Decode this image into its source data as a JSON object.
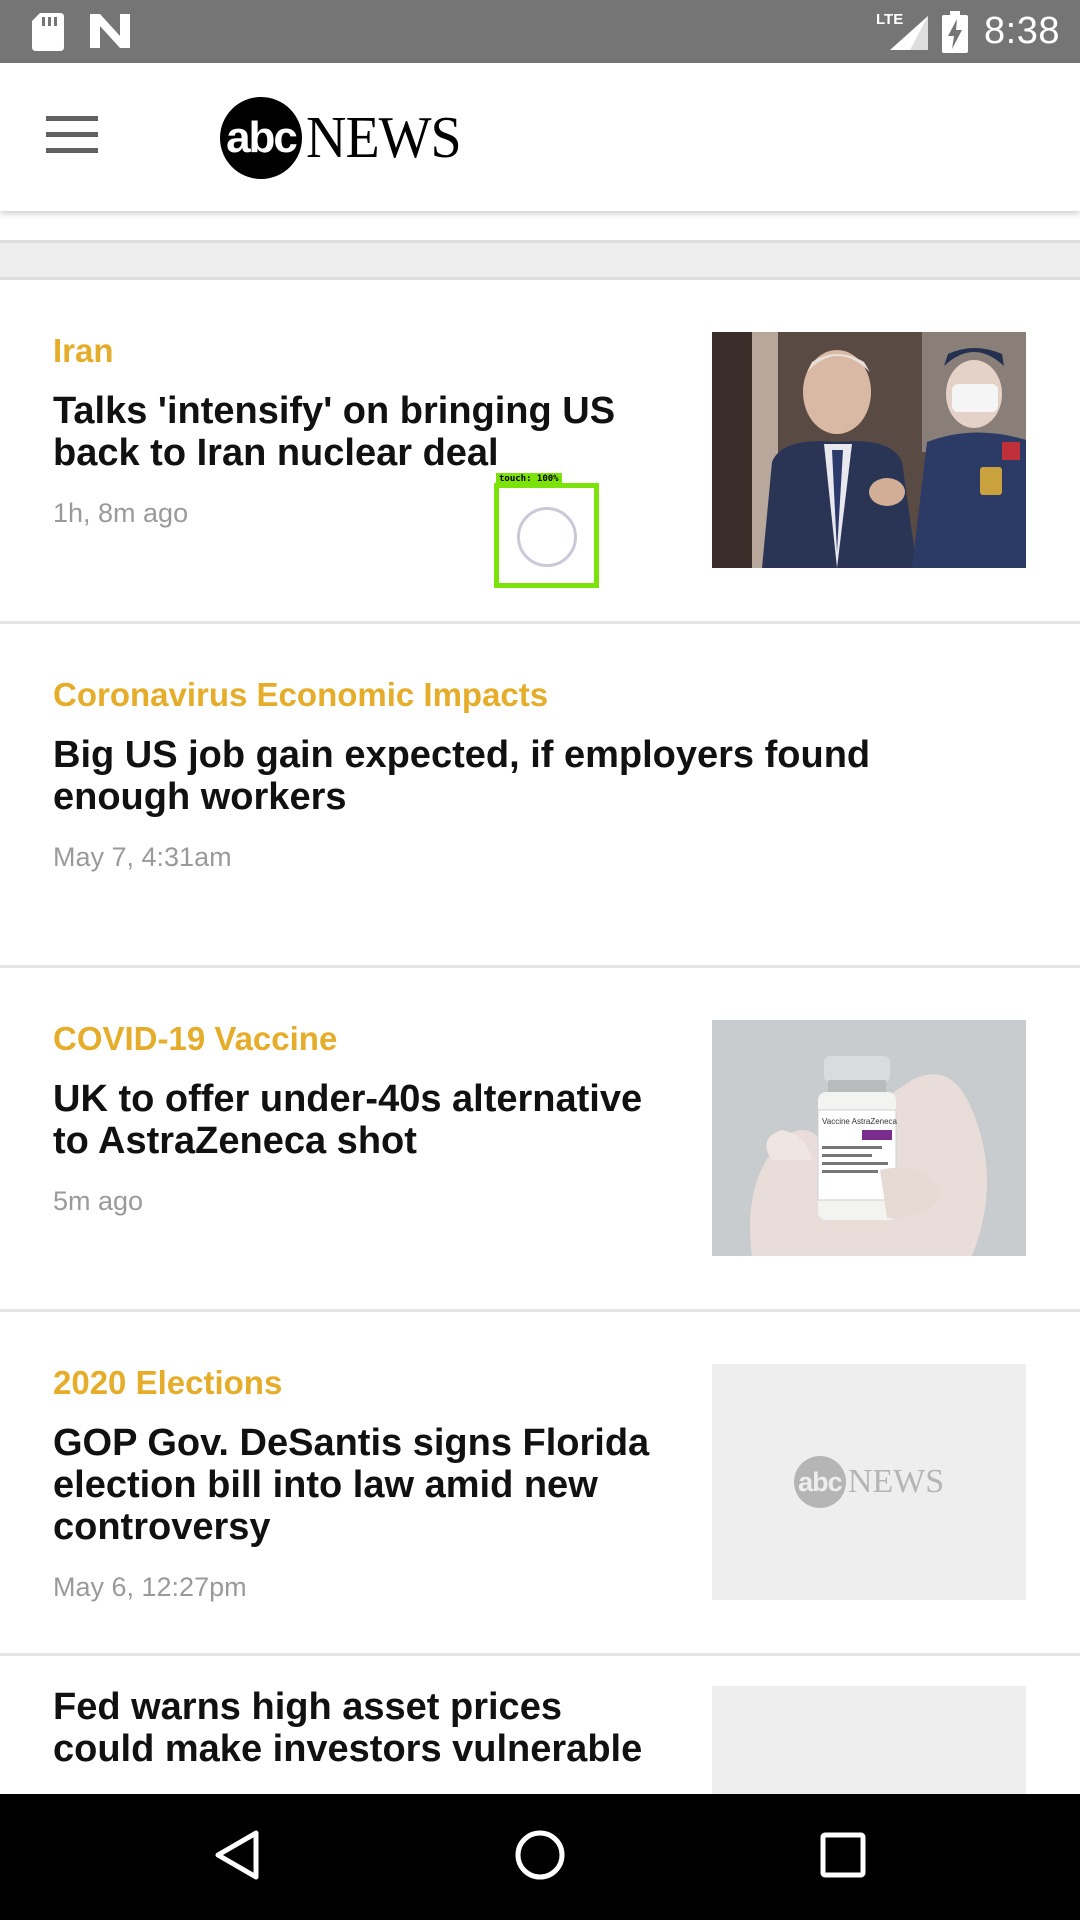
{
  "status_bar": {
    "time": "8:38",
    "network_label": "LTE",
    "icons": [
      "sd-card-icon",
      "n-notification-icon",
      "lte-signal-icon",
      "battery-charging-icon"
    ]
  },
  "header": {
    "logo_circle_text": "abc",
    "logo_word": "NEWS",
    "menu_icon": "hamburger-menu-icon"
  },
  "touch_overlay": {
    "label": "touch: 100%"
  },
  "articles": [
    {
      "category": "Iran",
      "headline": "Talks 'intensify' on bringing US back to Iran nuclear deal",
      "timestamp": "1h, 8m ago",
      "thumbnail": "photo-diplomat"
    },
    {
      "category": "Coronavirus Economic Impacts",
      "headline": "Big US job gain expected, if employers found enough workers",
      "timestamp": "May 7, 4:31am",
      "thumbnail": ""
    },
    {
      "category": "COVID-19 Vaccine",
      "headline": "UK to offer under-40s alternative to AstraZeneca shot",
      "timestamp": "5m ago",
      "thumbnail": "photo-vaccine-vial",
      "vial_label": "Vaccine AstraZeneca"
    },
    {
      "category": "2020 Elections",
      "headline": "GOP Gov. DeSantis signs Florida election bill into law amid new controversy",
      "timestamp": "May 6, 12:27pm",
      "thumbnail": "abc-news-placeholder",
      "placeholder_circle_text": "abc",
      "placeholder_word": "NEWS"
    },
    {
      "category": "",
      "headline": "Fed warns high asset prices could make investors vulnerable",
      "timestamp": "",
      "thumbnail": "placeholder"
    }
  ],
  "nav_bar": {
    "buttons": [
      "back-icon",
      "home-icon",
      "recents-icon"
    ]
  },
  "colors": {
    "category": "#e5ad2a",
    "status_bar": "#757575",
    "touch_indicator": "#7ce30a"
  }
}
